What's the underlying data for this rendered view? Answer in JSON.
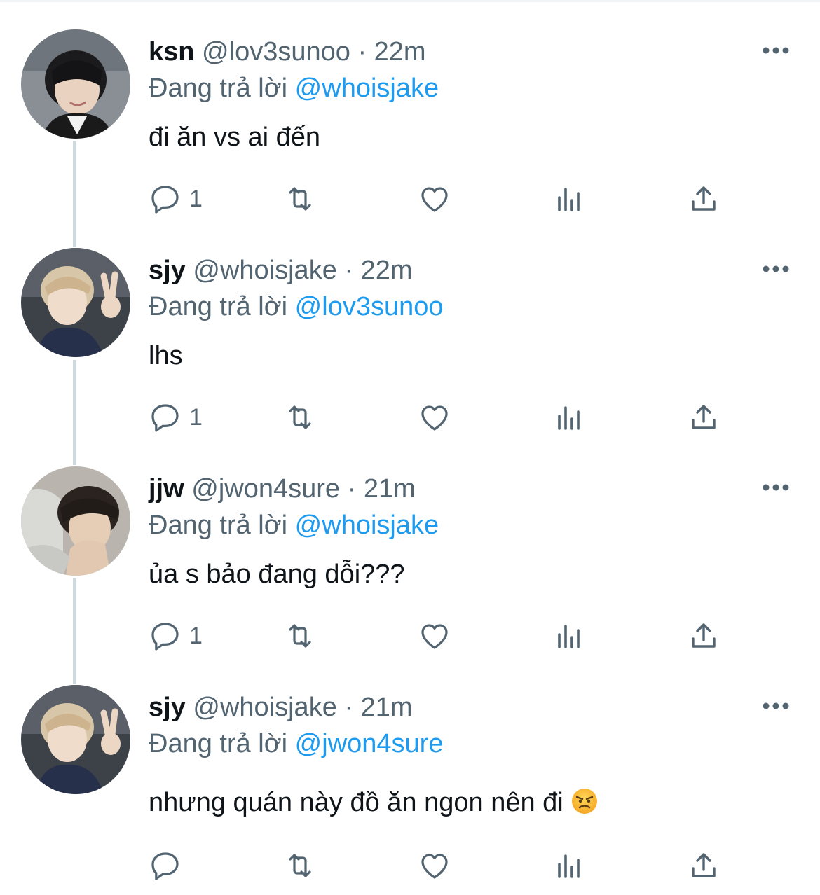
{
  "tweets": [
    {
      "name": "ksn",
      "handle": "@lov3sunoo",
      "dot": "·",
      "time": "22m",
      "reply_prefix": "Đang trả lời",
      "reply_to": "@whoisjake",
      "text": "đi ăn vs ai đến",
      "reply_count": "1",
      "avatar": "avatar-dark-hair-smile"
    },
    {
      "name": "sjy",
      "handle": "@whoisjake",
      "dot": "·",
      "time": "22m",
      "reply_prefix": "Đang trả lời",
      "reply_to": "@lov3sunoo",
      "text": "lhs",
      "reply_count": "1",
      "avatar": "avatar-blond-peace-sign"
    },
    {
      "name": "jjw",
      "handle": "@jwon4sure",
      "dot": "·",
      "time": "21m",
      "reply_prefix": "Đang trả lời",
      "reply_to": "@whoisjake",
      "text": "ủa s bảo đang dỗi???",
      "reply_count": "1",
      "avatar": "avatar-hoodie-hand-on-face"
    },
    {
      "name": "sjy",
      "handle": "@whoisjake",
      "dot": "·",
      "time": "21m",
      "reply_prefix": "Đang trả lời",
      "reply_to": "@jwon4sure",
      "text": "nhưng quán này đồ ăn ngon nên đi",
      "reply_count": "",
      "emoji": "angry-face-emoji",
      "avatar": "avatar-blond-peace-sign"
    }
  ],
  "icons": {
    "reply": "reply-bubble-icon",
    "retweet": "retweet-icon",
    "like": "heart-icon",
    "views": "views-bar-icon",
    "share": "share-icon",
    "more": "more-dots-icon"
  },
  "colors": {
    "text": "#0f1419",
    "secondary": "#536471",
    "link": "#1d9bf0",
    "thread_line": "#cfd9de"
  }
}
